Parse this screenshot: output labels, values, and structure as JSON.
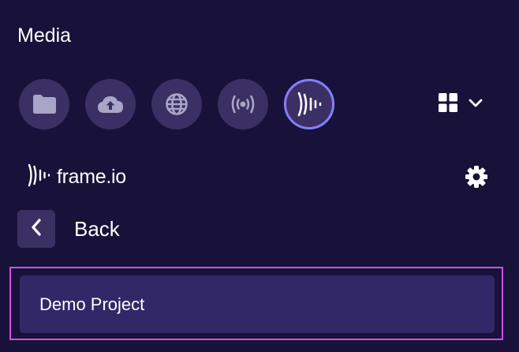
{
  "panel": {
    "title": "Media"
  },
  "sources": [
    {
      "icon": "folder-icon",
      "name": "source-local-folder"
    },
    {
      "icon": "cloud-upload-icon",
      "name": "source-upload"
    },
    {
      "icon": "globe-icon",
      "name": "source-web"
    },
    {
      "icon": "broadcast-icon",
      "name": "source-live"
    },
    {
      "icon": "frameio-icon",
      "name": "source-frameio",
      "active": true
    }
  ],
  "view_toggle": {
    "icon": "grid-icon",
    "dropdown_icon": "chevron-down-icon"
  },
  "provider": {
    "name": "frame.io",
    "settings_icon": "gear-icon"
  },
  "navigation": {
    "back_label": "Back"
  },
  "projects": [
    {
      "label": "Demo Project"
    }
  ],
  "colors": {
    "background": "#18123a",
    "button_bg": "#3a3064",
    "item_bg": "#322867",
    "active_ring": "#7a88ff",
    "highlight_border": "#d34ee6",
    "icon": "#a9a5c6"
  }
}
